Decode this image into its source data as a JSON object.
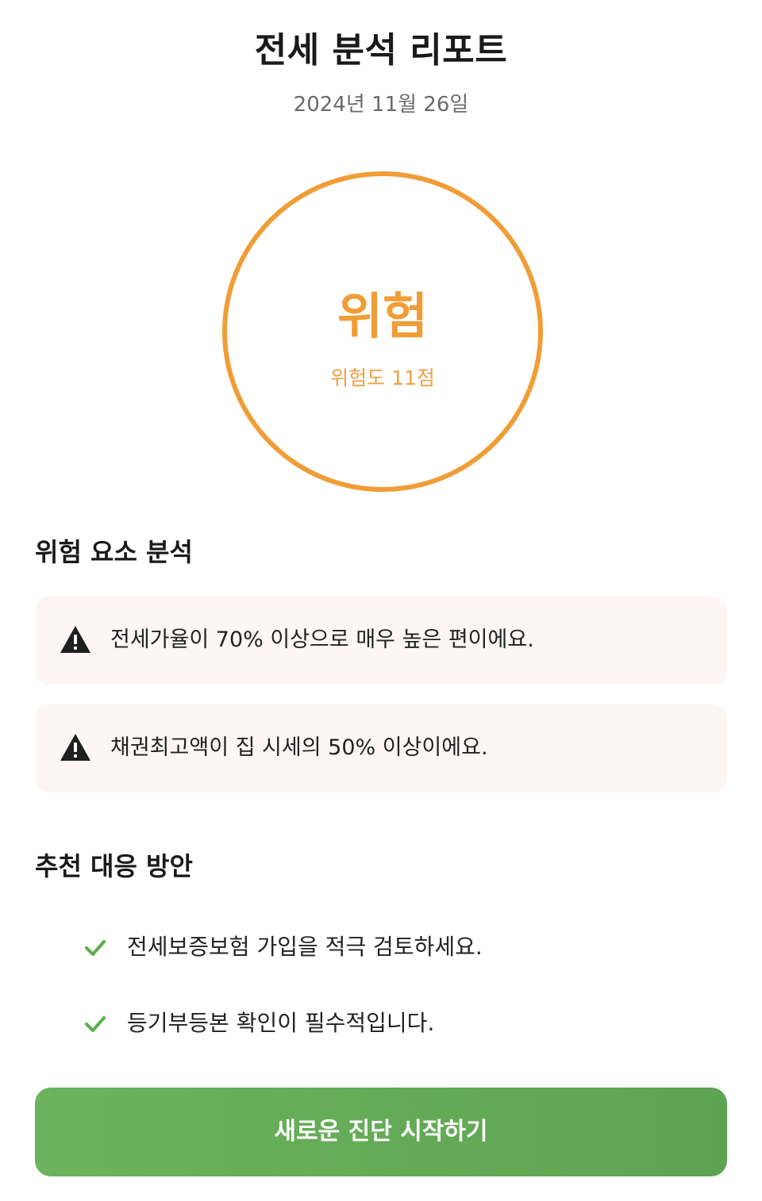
{
  "header": {
    "title": "전세 분석 리포트",
    "date": "2024년 11월 26일"
  },
  "risk_summary": {
    "level": "위험",
    "score_text": "위험도 11점",
    "accent_color": "#f09d36"
  },
  "risk_factors": {
    "title": "위험 요소 분석",
    "icon": "warning-icon",
    "items": [
      {
        "text": "전세가율이 70% 이상으로 매우 높은 편이에요."
      },
      {
        "text": "채권최고액이 집 시세의 50% 이상이에요."
      }
    ]
  },
  "recommendations": {
    "title": "추천 대응 방안",
    "icon": "check-icon",
    "icon_color": "#5aad4e",
    "items": [
      {
        "text": "전세보증보험 가입을 적극 검토하세요."
      },
      {
        "text": "등기부등본 확인이 필수적입니다."
      }
    ]
  },
  "actions": {
    "restart_label": "새로운 진단 시작하기",
    "button_color": "#63ab57"
  }
}
